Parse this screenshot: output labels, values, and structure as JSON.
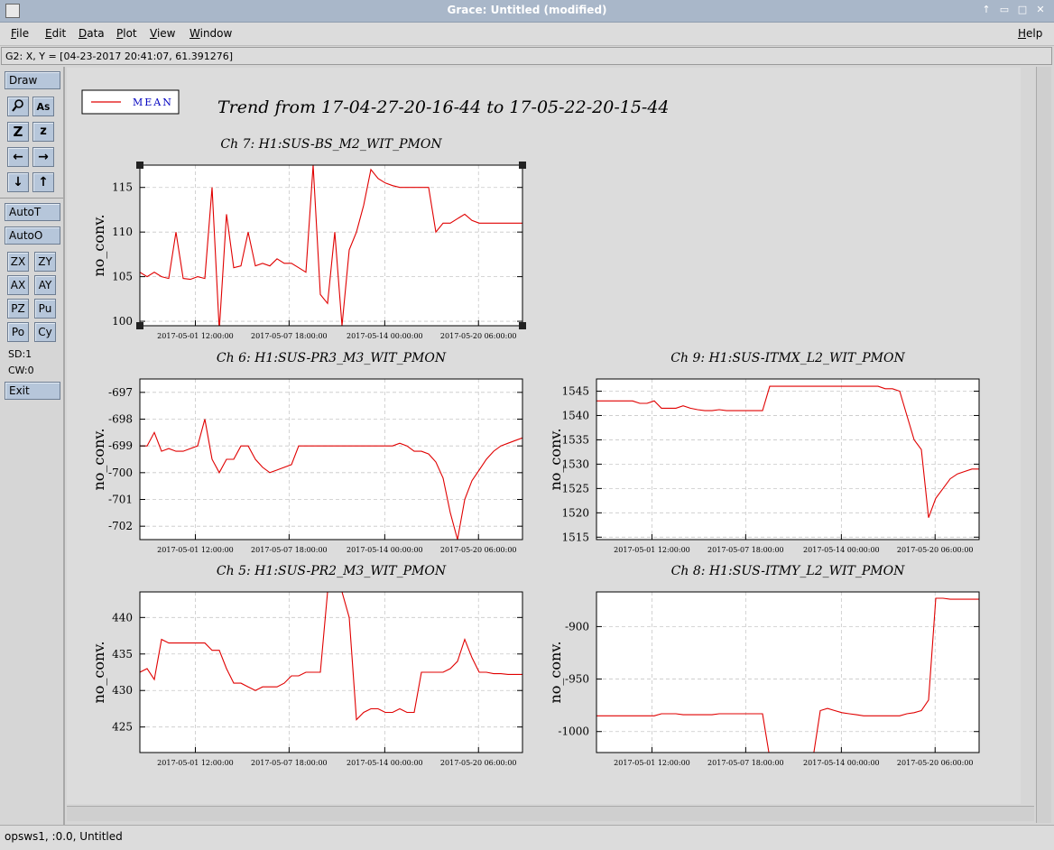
{
  "window": {
    "title": "Grace: Untitled (modified)"
  },
  "menu": [
    "File",
    "Edit",
    "Data",
    "Plot",
    "View",
    "Window",
    "Help"
  ],
  "locator": "G2: X, Y = [04-23-2017 20:41:07, 61.391276]",
  "toolbar": {
    "draw": "Draw",
    "autot": "AutoT",
    "autoo": "AutoO",
    "zx": "ZX",
    "zy": "ZY",
    "ax": "AX",
    "ay": "AY",
    "pz": "PZ",
    "pu": "Pu",
    "po": "Po",
    "cy": "Cy",
    "sd": "SD:1",
    "cw": "CW:0",
    "exit": "Exit",
    "icons": [
      "zoom-icon",
      "text-icon",
      "zoom-x-icon",
      "zoom-y-icon",
      "arrow-left-icon",
      "arrow-right-icon",
      "arrow-down-icon",
      "arrow-up-icon"
    ]
  },
  "status": "opsws1, :0.0, Untitled",
  "legend": {
    "label": "MEAN",
    "color": "#e00000"
  },
  "page_title": "Trend from 17-04-27-20-16-44 to 17-05-22-20-15-44",
  "colors": {
    "line": "#e00000",
    "grid": "#c8c8c8"
  },
  "chart_data": [
    {
      "type": "line",
      "title": "Ch 7: H1:SUS-BS_M2_WIT_PMON",
      "ylabel": "no_conv.",
      "xtick_labels": [
        "2017-05-01 12:00:00",
        "2017-05-07 18:00:00",
        "2017-05-14 00:00:00",
        "2017-05-20 06:00:00"
      ],
      "yticks": [
        100,
        105,
        110,
        115
      ],
      "ylim": [
        99.5,
        117.5
      ],
      "series": [
        {
          "name": "MEAN",
          "values": [
            105.5,
            105,
            105.5,
            105,
            104.8,
            110,
            104.8,
            104.7,
            105,
            104.8,
            115,
            99,
            112,
            106,
            106.2,
            110,
            106.2,
            106.5,
            106.2,
            107,
            106.5,
            106.5,
            106,
            105.5,
            117.5,
            103,
            102,
            110,
            99.5,
            108,
            110,
            113,
            117,
            116,
            115.5,
            115.2,
            115,
            115,
            115,
            115,
            115,
            110,
            111,
            111,
            111.5,
            112,
            111.3,
            111,
            111,
            111,
            111,
            111,
            111,
            111
          ]
        }
      ]
    },
    {
      "type": "line",
      "title": "Ch 6: H1:SUS-PR3_M3_WIT_PMON",
      "ylabel": "no_conv.",
      "xtick_labels": [
        "2017-05-01 12:00:00",
        "2017-05-07 18:00:00",
        "2017-05-14 00:00:00",
        "2017-05-20 06:00:00"
      ],
      "yticks": [
        -697,
        -698,
        -699,
        -700,
        -701,
        -702
      ],
      "ylim": [
        -702.5,
        -696.5
      ],
      "series": [
        {
          "name": "MEAN",
          "values": [
            -699,
            -699,
            -698.5,
            -699.2,
            -699.1,
            -699.2,
            -699.2,
            -699.1,
            -699,
            -698,
            -699.5,
            -700,
            -699.5,
            -699.5,
            -699,
            -699,
            -699.5,
            -699.8,
            -700,
            -699.9,
            -699.8,
            -699.7,
            -699,
            -699,
            -699,
            -699,
            -699,
            -699,
            -699,
            -699,
            -699,
            -699,
            -699,
            -699,
            -699,
            -699,
            -698.9,
            -699,
            -699.2,
            -699.2,
            -699.3,
            -699.6,
            -700.2,
            -701.5,
            -702.5,
            -701,
            -700.3,
            -699.9,
            -699.5,
            -699.2,
            -699,
            -698.9,
            -698.8,
            -698.7
          ]
        }
      ]
    },
    {
      "type": "line",
      "title": "Ch 9: H1:SUS-ITMX_L2_WIT_PMON",
      "ylabel": "no_conv.",
      "xtick_labels": [
        "2017-05-01 12:00:00",
        "2017-05-07 18:00:00",
        "2017-05-14 00:00:00",
        "2017-05-20 06:00:00"
      ],
      "yticks": [
        1515,
        1520,
        1525,
        1530,
        1535,
        1540,
        1545
      ],
      "ylim": [
        1514.5,
        1547.5
      ],
      "series": [
        {
          "name": "MEAN",
          "values": [
            1543,
            1543,
            1543,
            1543,
            1543,
            1543,
            1542.5,
            1542.5,
            1543,
            1541.5,
            1541.5,
            1541.5,
            1542,
            1541.5,
            1541.2,
            1541,
            1541,
            1541.2,
            1541,
            1541,
            1541,
            1541,
            1541,
            1541,
            1546,
            1546,
            1546,
            1546,
            1546,
            1546,
            1546,
            1546,
            1546,
            1546,
            1546,
            1546,
            1546,
            1546,
            1546,
            1546,
            1545.5,
            1545.5,
            1545,
            1540,
            1535,
            1533,
            1519,
            1523,
            1525,
            1527,
            1528,
            1528.5,
            1529,
            1529
          ]
        }
      ]
    },
    {
      "type": "line",
      "title": "Ch 5: H1:SUS-PR2_M3_WIT_PMON",
      "ylabel": "no_conv.",
      "xtick_labels": [
        "2017-05-01 12:00:00",
        "2017-05-07 18:00:00",
        "2017-05-14 00:00:00",
        "2017-05-20 06:00:00"
      ],
      "yticks": [
        425,
        430,
        435,
        440
      ],
      "ylim": [
        421.5,
        443.5
      ],
      "series": [
        {
          "name": "MEAN",
          "values": [
            432.5,
            433,
            431.5,
            437,
            436.5,
            436.5,
            436.5,
            436.5,
            436.5,
            436.5,
            435.5,
            435.5,
            433,
            431,
            431,
            430.5,
            430,
            430.5,
            430.5,
            430.5,
            431,
            432,
            432,
            432.5,
            432.5,
            432.5,
            443.5,
            443.5,
            443.5,
            440,
            426,
            427,
            427.5,
            427.5,
            427,
            427,
            427.5,
            427,
            427,
            432.5,
            432.5,
            432.5,
            432.5,
            433,
            434,
            437,
            434.5,
            432.5,
            432.5,
            432.3,
            432.3,
            432.2,
            432.2,
            432.2
          ]
        }
      ]
    },
    {
      "type": "line",
      "title": "Ch 8: H1:SUS-ITMY_L2_WIT_PMON",
      "ylabel": "no_conv.",
      "xtick_labels": [
        "2017-05-01 12:00:00",
        "2017-05-07 18:00:00",
        "2017-05-14 00:00:00",
        "2017-05-20 06:00:00"
      ],
      "yticks": [
        -900,
        -950,
        -1000
      ],
      "ylim": [
        -1020,
        -867
      ],
      "series": [
        {
          "name": "MEAN",
          "values": [
            -985,
            -985,
            -985,
            -985,
            -985,
            -985,
            -985,
            -985,
            -985,
            -983,
            -983,
            -983,
            -984,
            -984,
            -984,
            -984,
            -984,
            -983,
            -983,
            -983,
            -983,
            -983,
            -983,
            -983,
            -1025,
            -1025,
            -1025,
            -1025,
            -1025,
            -1025,
            -1025,
            -980,
            -978,
            -980,
            -982,
            -983,
            -984,
            -985,
            -985,
            -985,
            -985,
            -985,
            -985,
            -983,
            -982,
            -980,
            -970,
            -873,
            -873,
            -874,
            -874,
            -874,
            -874,
            -874
          ]
        }
      ]
    }
  ]
}
